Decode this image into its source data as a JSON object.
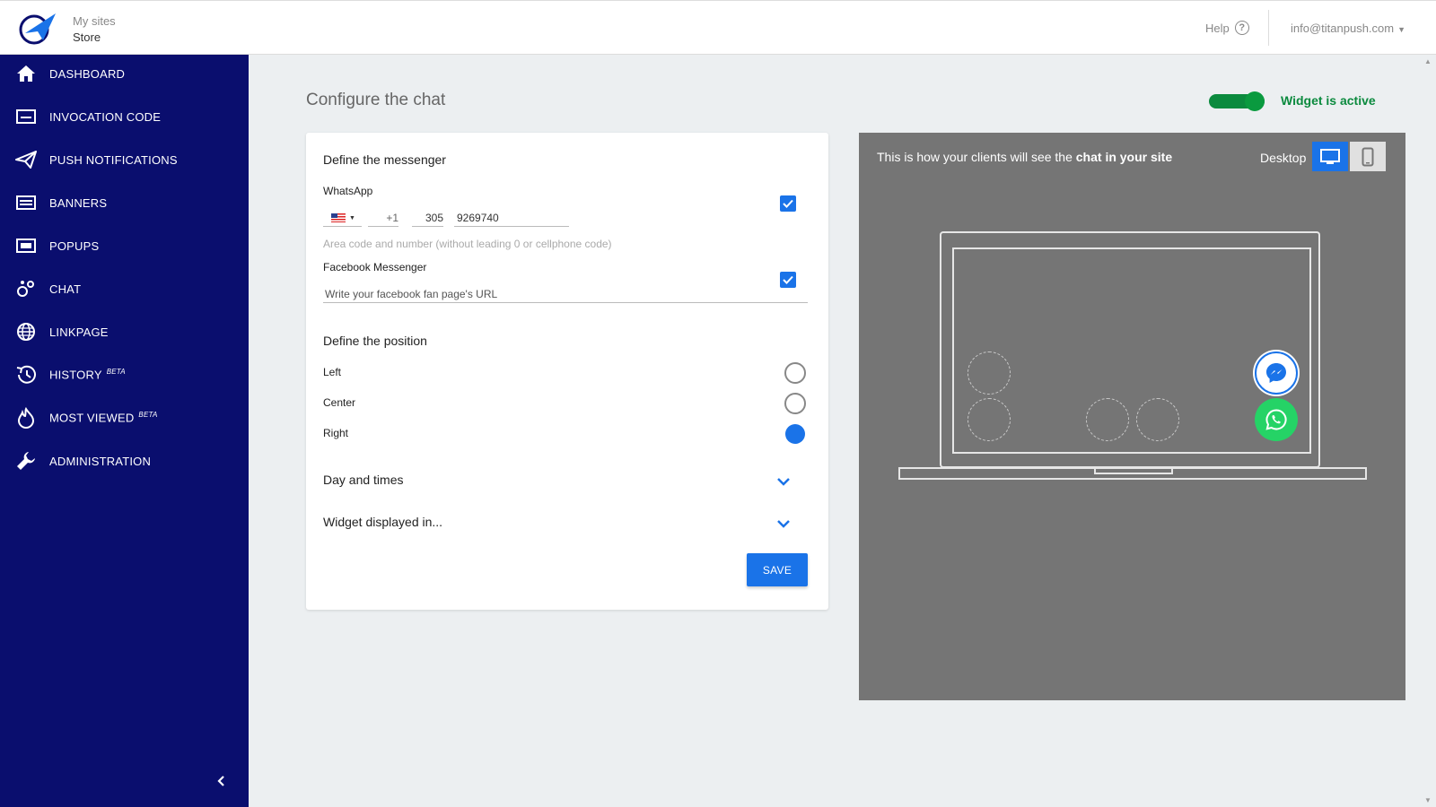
{
  "header": {
    "site_label": "My sites",
    "site_name": "Store",
    "help_label": "Help",
    "user_email": "info@titanpush.com"
  },
  "sidebar": {
    "items": [
      {
        "label": "DASHBOARD",
        "icon": "home-icon"
      },
      {
        "label": "INVOCATION CODE",
        "icon": "code-icon"
      },
      {
        "label": "PUSH NOTIFICATIONS",
        "icon": "paper-plane-icon"
      },
      {
        "label": "BANNERS",
        "icon": "banner-icon"
      },
      {
        "label": "POPUPS",
        "icon": "popup-icon"
      },
      {
        "label": "CHAT",
        "icon": "chat-bubbles-icon"
      },
      {
        "label": "LINKPAGE",
        "icon": "globe-icon"
      },
      {
        "label": "HISTORY",
        "badge": "BETA",
        "icon": "history-icon"
      },
      {
        "label": "MOST VIEWED",
        "badge": "BETA",
        "icon": "flame-icon"
      },
      {
        "label": "ADMINISTRATION",
        "icon": "wrench-icon"
      }
    ]
  },
  "main": {
    "title": "Configure the chat",
    "widget_active_label": "Widget is active",
    "messenger": {
      "section_title": "Define the messenger",
      "whatsapp_label": "WhatsApp",
      "whatsapp_checked": true,
      "dial_code": "+1",
      "area_code": "305",
      "phone_number": "9269740",
      "phone_hint": "Area code and number (without leading 0 or cellphone code)",
      "facebook_label": "Facebook Messenger",
      "facebook_checked": true,
      "facebook_placeholder": "Write your facebook fan page's URL"
    },
    "position": {
      "section_title": "Define the position",
      "options": [
        "Left",
        "Center",
        "Right"
      ],
      "selected": "Right"
    },
    "day_times_label": "Day and times",
    "displayed_in_label": "Widget displayed in...",
    "save_label": "SAVE"
  },
  "preview": {
    "caption_prefix": "This is how your clients will see the ",
    "caption_bold": "chat in your site",
    "device_label": "Desktop",
    "selected_device": "desktop"
  },
  "colors": {
    "sidebar_bg": "#0a0e6e",
    "accent": "#1a73e8",
    "active_green": "#0b8a3e",
    "preview_bg": "#757575",
    "whatsapp_green": "#25d366"
  }
}
